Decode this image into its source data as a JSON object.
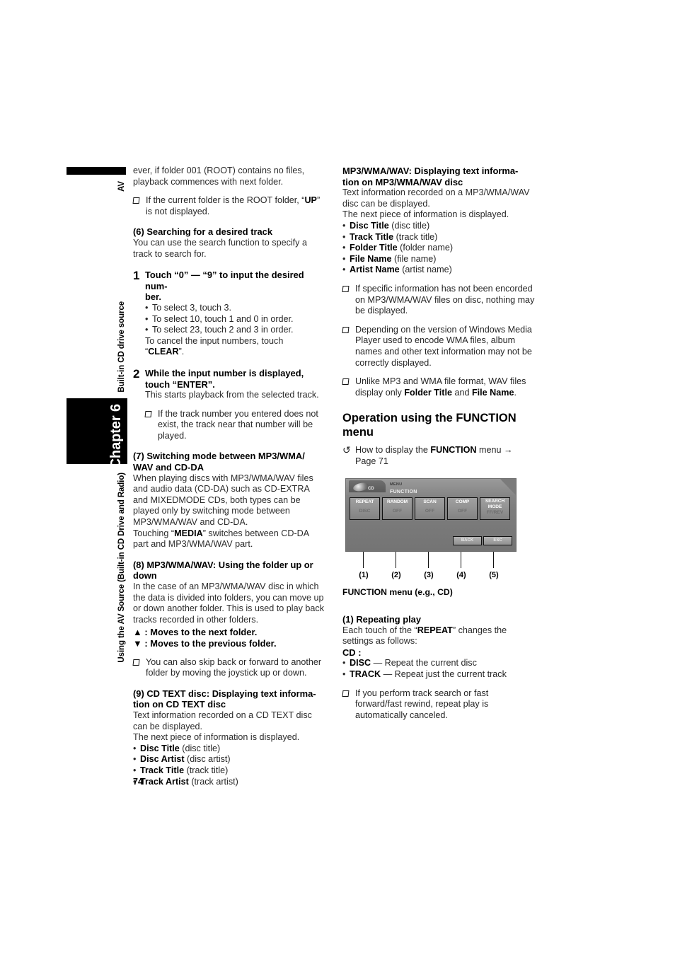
{
  "page": {
    "number": "74"
  },
  "sidebar": {
    "av_label": "AV",
    "source_label": "Built-in CD drive source",
    "chapter_label": "Chapter 6",
    "section_label": "Using the AV Source (Built-in CD Drive and Radio)"
  },
  "left_column": {
    "continued_paragraph": "ever, if folder 001 (ROOT) contains no files, playback commences with next folder.",
    "note_root": "If the current folder is the ROOT folder, “UP” is not displayed.",
    "note_root_parts": {
      "a": "If the current folder is the ROOT folder, “",
      "b": "UP",
      "c": "” is not displayed."
    },
    "section6": {
      "heading": "(6) Searching for a desired track",
      "body": "You can use the search function to specify a track to search for.",
      "step1": {
        "num": "1",
        "title_a": "Touch “0” — “9” to input the desired num-",
        "title_b": "ber.",
        "bullets": [
          "To select 3, touch 3.",
          "To select 10, touch 1 and 0 in order.",
          "To select 23, touch 2 and 3 in order."
        ],
        "cancel_a": "To cancel the input numbers, touch",
        "cancel_b": "“",
        "cancel_c": "CLEAR",
        "cancel_d": "”."
      },
      "step2": {
        "num": "2",
        "title_a": "While the input number is displayed,",
        "title_b": "touch “ENTER”.",
        "body": "This starts playback from the selected track.",
        "note": "If the track number you entered does not exist, the track near that number will be played."
      }
    },
    "section7": {
      "heading_a": "(7) Switching mode between MP3/WMA/",
      "heading_b": "WAV and CD-DA",
      "body": "When playing discs with MP3/WMA/WAV files and audio data (CD-DA) such as CD-EXTRA and MIXEDMODE CDs, both types can be played only by switching mode between MP3/WMA/WAV and CD-DA.",
      "media_a": "Touching “",
      "media_b": "MEDIA",
      "media_c": "” switches between CD-DA part and MP3/WMA/WAV part."
    },
    "section8": {
      "heading_a": "(8) MP3/WMA/WAV: Using the folder up or",
      "heading_b": "down",
      "body": "In the case of an MP3/WMA/WAV disc in which the data is divided into folders, you can move up or down another folder. This is used to play back tracks recorded in other folders.",
      "up_line": "▲ : Moves to the next folder.",
      "down_line": "▼ : Moves to the previous folder.",
      "note": "You can also skip back or forward to another folder by moving the joystick up or down."
    },
    "section9": {
      "heading_a": "(9) CD TEXT disc: Displaying text informa-",
      "heading_b": "tion on CD TEXT disc",
      "body_a": "Text information recorded on a CD TEXT disc can be displayed.",
      "body_b": "The next piece of information is displayed.",
      "items": [
        {
          "bold": "Disc Title",
          "rest": "(disc title)"
        },
        {
          "bold": "Disc Artist",
          "rest": "(disc artist)"
        },
        {
          "bold": "Track Title",
          "rest": "(track title)"
        },
        {
          "bold": "Track Artist",
          "rest": "(track artist)"
        }
      ]
    }
  },
  "right_column": {
    "section_mp3text": {
      "heading_a": "MP3/WMA/WAV: Displaying text informa-",
      "heading_b": "tion on MP3/WMA/WAV disc",
      "body_a": "Text information recorded on a MP3/WMA/WAV disc can be displayed.",
      "body_b": "The next piece of information is displayed.",
      "items": [
        {
          "bold": "Disc Title",
          "rest": "(disc title)"
        },
        {
          "bold": "Track Title",
          "rest": "(track title)"
        },
        {
          "bold": "Folder Title",
          "rest": "(folder name)"
        },
        {
          "bold": "File Name",
          "rest": "(file name)"
        },
        {
          "bold": "Artist Name",
          "rest": "(artist name)"
        }
      ],
      "note1": "If specific information has not been encorded on MP3/WMA/WAV files on disc, nothing may be displayed.",
      "note2": "Depending on the version of Windows Media Player used to encode WMA files, album names and other text information may not be correctly displayed.",
      "note3": {
        "a": "Unlike MP3 and WMA file format, WAV files display only ",
        "b": "Folder Title",
        "c": " and ",
        "d": "File Name",
        "e": "."
      }
    },
    "function_menu": {
      "heading_a": "Operation using the FUNCTION",
      "heading_b": "menu",
      "ref": {
        "arrow": "↺",
        "a": "How to display the ",
        "b": "FUNCTION",
        "c": " menu →",
        "d": "Page 71"
      },
      "figure": {
        "tab_label": "CD",
        "menu_label": "MENU",
        "function_label": "FUNCTION",
        "buttons": [
          {
            "line1": "REPEAT",
            "line2": "DISC"
          },
          {
            "line1": "RANDOM",
            "line2": "OFF"
          },
          {
            "line1": "SCAN",
            "line2": "OFF"
          },
          {
            "line1": "COMP",
            "line2": "OFF"
          },
          {
            "line1": "SEARCH MODE",
            "line2": "FF/REV"
          }
        ],
        "back_label": "BACK",
        "esc_label": "ESC",
        "callouts": [
          "(1)",
          "(2)",
          "(3)",
          "(4)",
          "(5)"
        ],
        "caption_a": "FUNCTION",
        "caption_b": " menu (e.g., ",
        "caption_c": "CD",
        "caption_d": ")"
      }
    },
    "section_repeat": {
      "heading": "(1) Repeating play",
      "body_a": "Each touch of the “",
      "body_b": "REPEAT",
      "body_c": "” changes the settings as follows:",
      "cd_label": "CD :",
      "items": [
        {
          "bold": "DISC",
          "rest": "— Repeat the current disc"
        },
        {
          "bold": "TRACK",
          "rest": "— Repeat just the current track"
        }
      ],
      "note": "If you perform track search or fast forward/fast rewind, repeat play is automatically canceled."
    }
  }
}
